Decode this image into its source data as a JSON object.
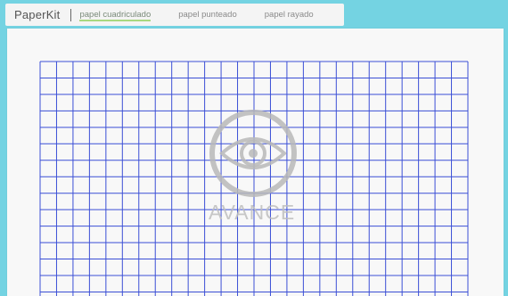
{
  "header": {
    "brand": "PaperKit",
    "tabs": [
      {
        "label": "papel cuadriculado",
        "active": true
      },
      {
        "label": "papel punteado",
        "active": false
      },
      {
        "label": "papel rayado",
        "active": false
      }
    ]
  },
  "paper": {
    "grid_color": "#3b4fd6",
    "columns": 26,
    "rows": 14
  },
  "watermark": {
    "text": "AVANCE",
    "icon": "eye-icon"
  }
}
